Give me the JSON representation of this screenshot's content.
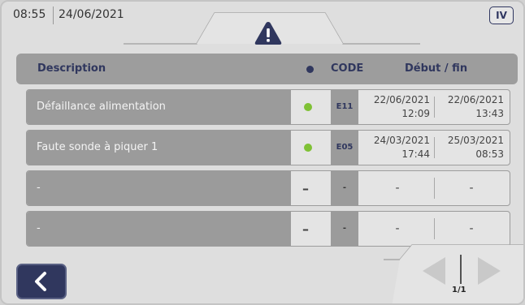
{
  "status": {
    "time": "08:55",
    "date": "24/06/2021",
    "level": "IV"
  },
  "icons": {
    "tab": "warning-icon",
    "back": "back-arrow-icon",
    "prev": "prev-page-icon",
    "next": "next-page-icon"
  },
  "colors": {
    "accent": "#30375e",
    "status_active": "#7fc135",
    "row_desc_bg": "#9b9b9b",
    "header_bg": "#9d9d9d"
  },
  "table": {
    "headers": {
      "description": "Description",
      "code": "CODE",
      "dates": "Début / fin"
    },
    "rows": [
      {
        "description": "Défaillance alimentation",
        "status": "active",
        "code": "E11",
        "start_date": "22/06/2021",
        "start_time": "12:09",
        "end_date": "22/06/2021",
        "end_time": "13:43"
      },
      {
        "description": "Faute sonde à piquer 1",
        "status": "active",
        "code": "E05",
        "start_date": "24/03/2021",
        "start_time": "17:44",
        "end_date": "25/03/2021",
        "end_time": "08:53"
      },
      {
        "description": "-",
        "status": "none",
        "status_text": "–",
        "code": "-",
        "start": "-",
        "end": "-"
      },
      {
        "description": "-",
        "status": "none",
        "status_text": "–",
        "code": "-",
        "start": "-",
        "end": "-"
      }
    ]
  },
  "pager": {
    "page": "1/1"
  }
}
